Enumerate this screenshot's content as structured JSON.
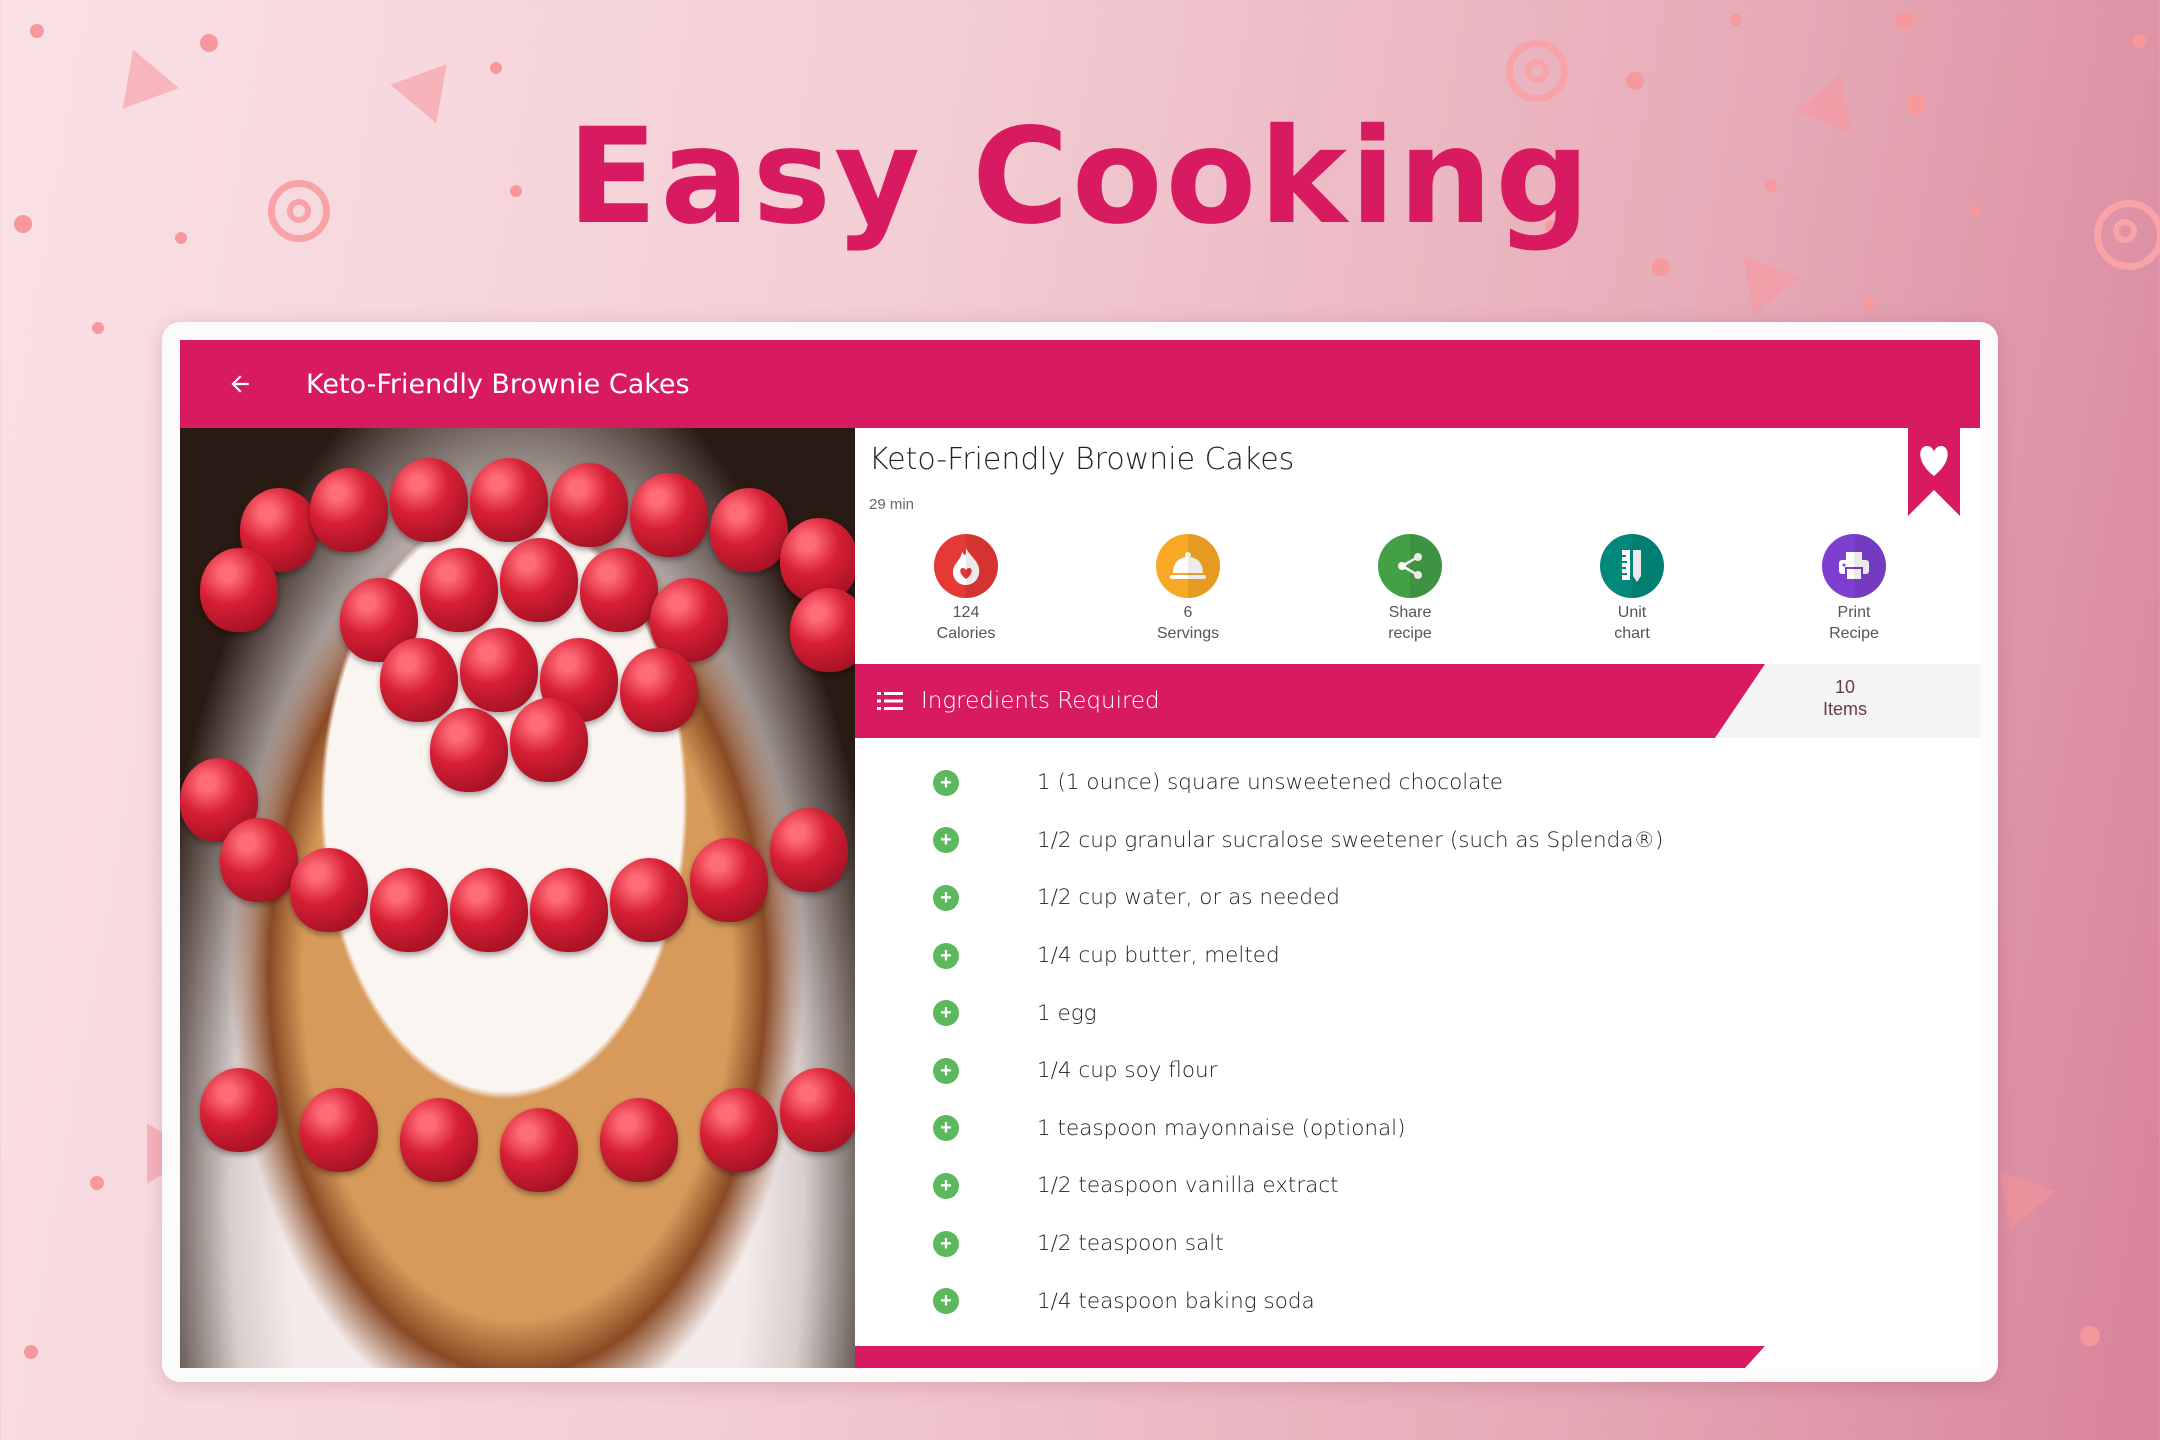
{
  "banner": {
    "title": "Easy Cooking"
  },
  "toolbar": {
    "back_icon": "arrow-left-icon",
    "title": "Keto-Friendly Brownie Cakes"
  },
  "recipe": {
    "title": "Keto-Friendly Brownie Cakes",
    "time": "29 min",
    "favorite_icon": "heart-bookmark-icon",
    "photo_alt": "Cake topped with whipped cream and raspberries"
  },
  "actions": [
    {
      "icon": "calorie-flame-icon",
      "line1": "124",
      "line2": "Calories",
      "color": "#e53935"
    },
    {
      "icon": "serving-cloche-icon",
      "line1": "6",
      "line2": "Servings",
      "color": "#f9a825"
    },
    {
      "icon": "share-icon",
      "line1": "Share",
      "line2": "recipe",
      "color": "#43a047"
    },
    {
      "icon": "ruler-pencil-icon",
      "line1": "Unit",
      "line2": "chart",
      "color": "#00897b"
    },
    {
      "icon": "printer-icon",
      "line1": "Print",
      "line2": "Recipe",
      "color": "#7e3fd1"
    }
  ],
  "ingredients": {
    "header_icon": "list-icon",
    "title": "Ingredients Required",
    "count": "10",
    "count_label": "Items",
    "items": [
      "1 (1 ounce) square unsweetened chocolate",
      "1/2 cup granular sucralose sweetener (such as Splenda®)",
      "1/2 cup water, or as needed",
      "1/4 cup butter, melted",
      "1 egg",
      "1/4 cup soy flour",
      "1 teaspoon mayonnaise (optional)",
      "1/2 teaspoon vanilla extract",
      "1/2 teaspoon salt",
      "1/4 teaspoon baking soda"
    ],
    "add_icon": "plus-circle-icon"
  },
  "colors": {
    "brand": "#d81b60",
    "add": "#5cb85c"
  }
}
